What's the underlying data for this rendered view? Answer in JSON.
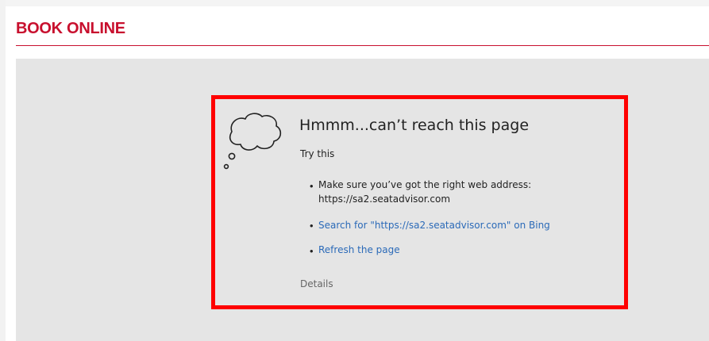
{
  "header": {
    "title": "BOOK ONLINE"
  },
  "error": {
    "heading": "Hmmm...can’t reach this page",
    "try_label": "Try this",
    "suggestions": [
      {
        "line1": "Make sure you’ve got the right web address:",
        "line2": "https://sa2.seatadvisor.com"
      },
      {
        "text": "Search for \"https://sa2.seatadvisor.com\" on Bing"
      },
      {
        "text": "Refresh the page"
      }
    ],
    "details_label": "Details"
  },
  "icons": {
    "thought": "thought-cloud-icon"
  },
  "colors": {
    "brand_red": "#c8102e",
    "highlight_border": "#ff0000",
    "frame_bg": "#e5e5e5",
    "link_blue": "#2b6ab8"
  }
}
